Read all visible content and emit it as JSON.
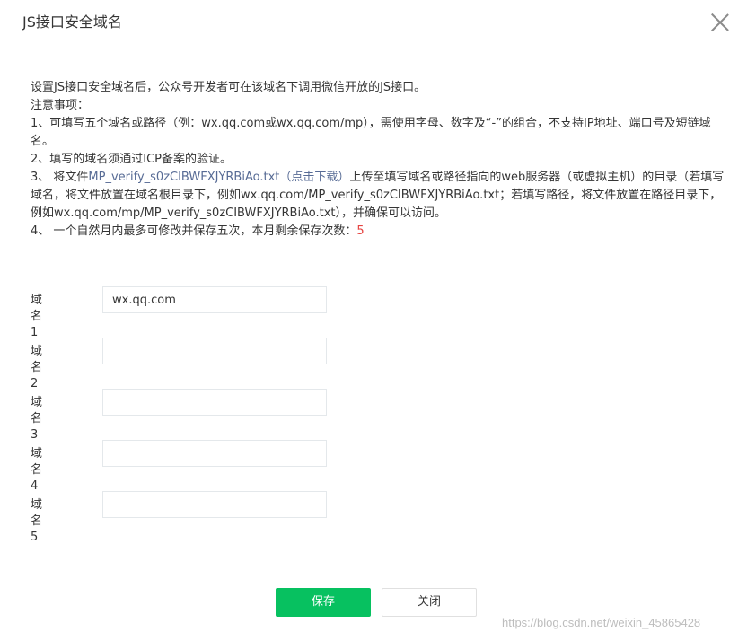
{
  "dialog": {
    "title": "JS接口安全域名"
  },
  "description": {
    "intro": "设置JS接口安全域名后，公众号开发者可在该域名下调用微信开放的JS接口。",
    "notes_heading": "注意事项：",
    "note1": "1、可填写五个域名或路径（例：wx.qq.com或wx.qq.com/mp），需使用字母、数字及“-”的组合，不支持IP地址、端口号及短链域名。",
    "note2": "2、填写的域名须通过ICP备案的验证。",
    "note3_prefix": "3、 将文件",
    "note3_link": "MP_verify_s0zCIBWFXJYRBiAo.txt（点击下载）",
    "note3_suffix": "上传至填写域名或路径指向的web服务器（或虚拟主机）的目录（若填写域名，将文件放置在域名根目录下，例如wx.qq.com/MP_verify_s0zCIBWFXJYRBiAo.txt；若填写路径，将文件放置在路径目录下，例如wx.qq.com/mp/MP_verify_s0zCIBWFXJYRBiAo.txt），并确保可以访问。",
    "note4_prefix": "4、 一个自然月内最多可修改并保存五次，本月剩余保存次数：",
    "note4_count": "5"
  },
  "form": {
    "fields": [
      {
        "label": "域名1",
        "value": "wx.qq.com"
      },
      {
        "label": "域名2",
        "value": ""
      },
      {
        "label": "域名3",
        "value": ""
      },
      {
        "label": "域名4",
        "value": ""
      },
      {
        "label": "域名5",
        "value": ""
      }
    ]
  },
  "buttons": {
    "save": "保存",
    "close": "关闭"
  },
  "watermark": "https://blog.csdn.net/weixin_45865428",
  "colors": {
    "primary": "#07c160",
    "link": "#576b95",
    "count": "#e64340"
  }
}
